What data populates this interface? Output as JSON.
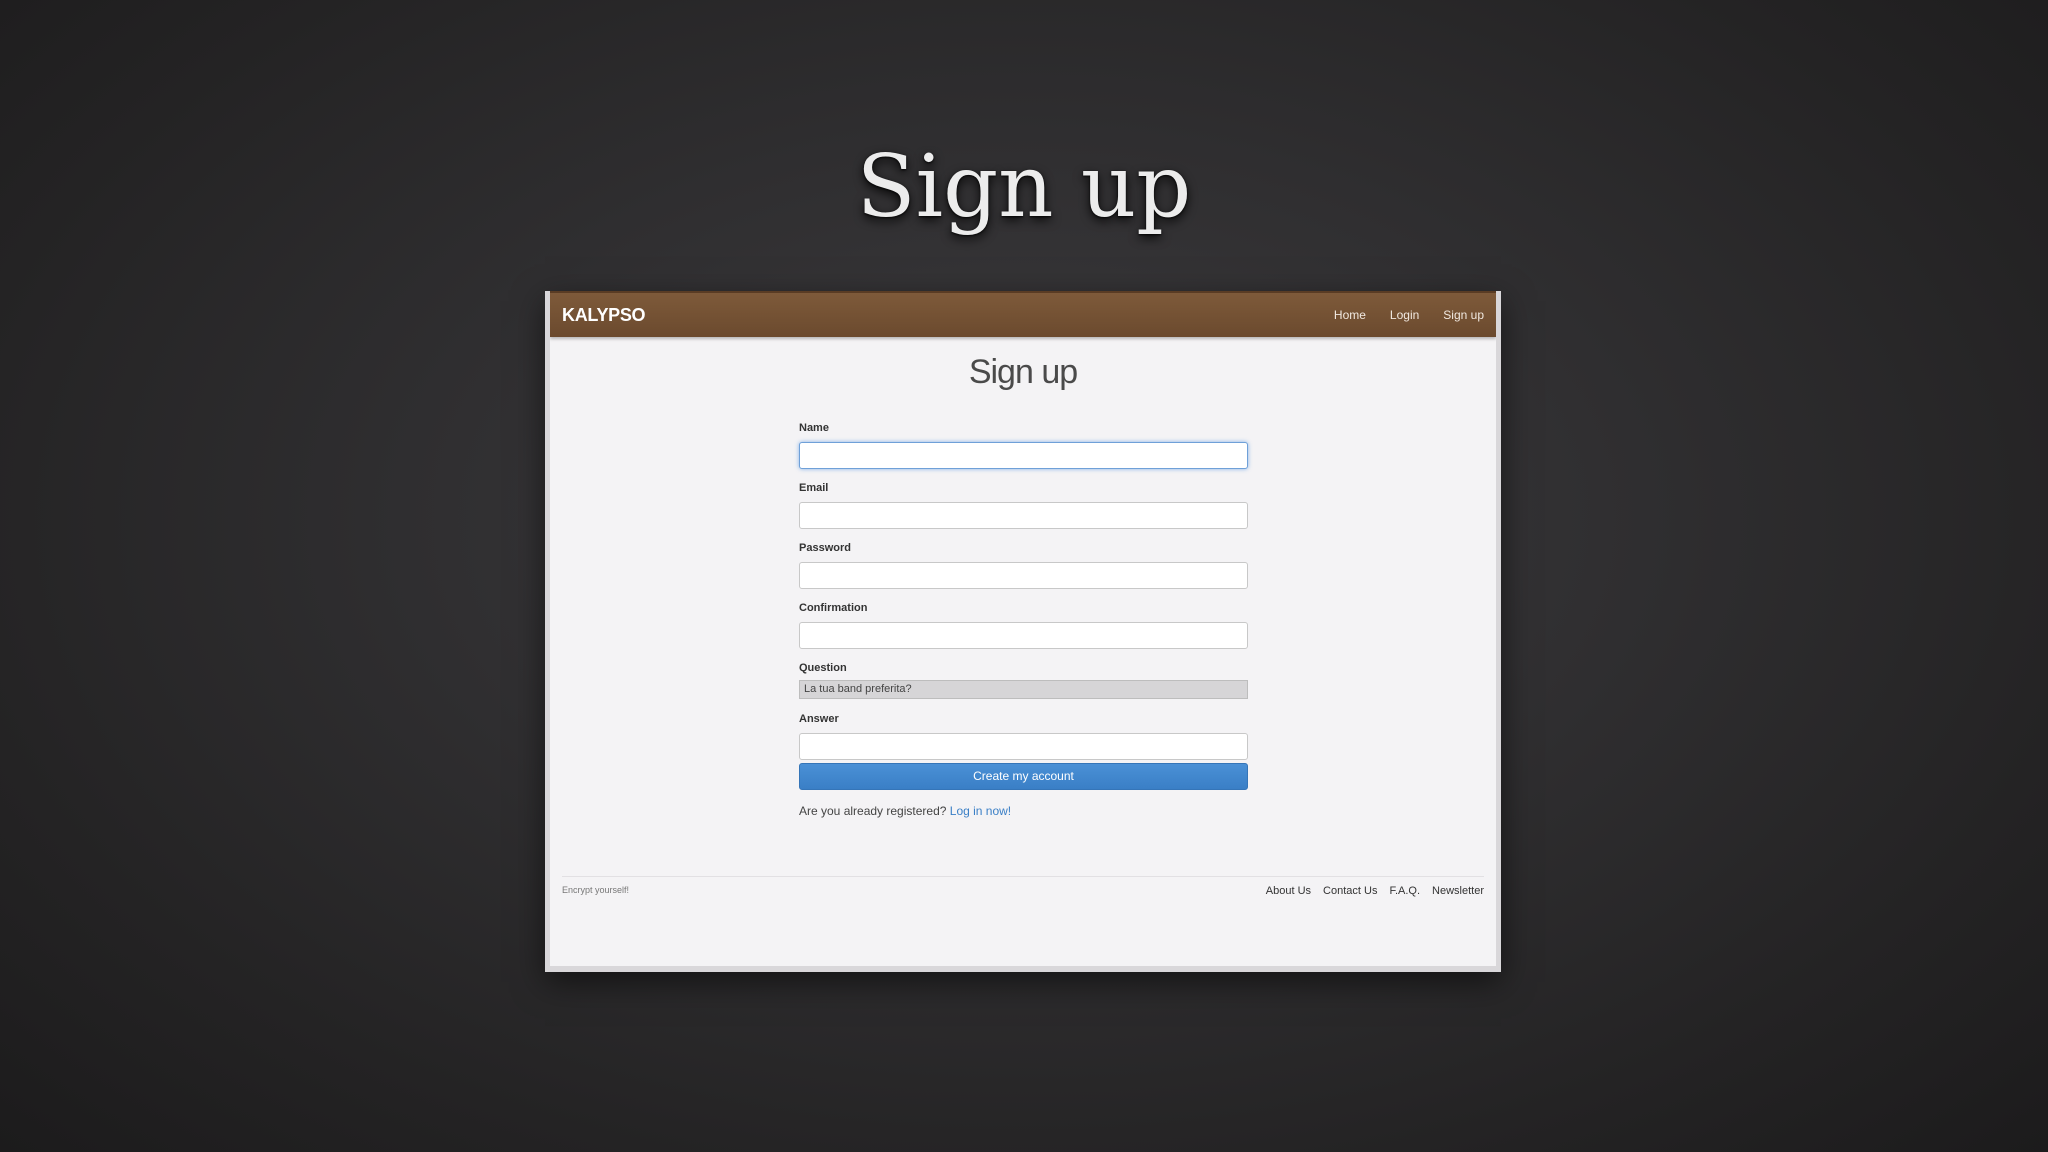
{
  "slide": {
    "title": "Sign up"
  },
  "navbar": {
    "brand": "KALYPSO",
    "links": [
      "Home",
      "Login",
      "Sign up"
    ]
  },
  "form": {
    "heading": "Sign up",
    "fields": {
      "name_label": "Name",
      "name_value": "",
      "email_label": "Email",
      "email_value": "",
      "password_label": "Password",
      "password_value": "",
      "confirmation_label": "Confirmation",
      "confirmation_value": "",
      "question_label": "Question",
      "question_selected": "La tua band preferita?",
      "answer_label": "Answer",
      "answer_value": ""
    },
    "submit_label": "Create my account",
    "login_prompt": "Are you already registered?",
    "login_link": "Log in now!"
  },
  "footer": {
    "tagline": "Encrypt yourself!",
    "links": [
      "About Us",
      "Contact Us",
      "F.A.Q.",
      "Newsletter"
    ]
  },
  "colors": {
    "navbar": "#765436",
    "button": "#4186cf",
    "link": "#3a7fc6"
  }
}
